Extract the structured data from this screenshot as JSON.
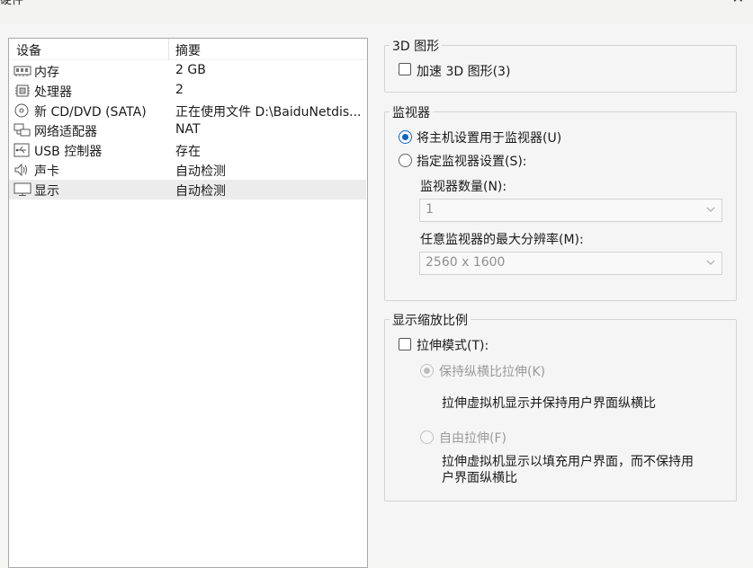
{
  "window": {
    "title": "硬件",
    "close_icon": "close-icon"
  },
  "devices": {
    "col_device": "设备",
    "col_summary": "摘要",
    "items": [
      {
        "name": "内存",
        "summary": "2 GB",
        "icon": "memory-icon"
      },
      {
        "name": "处理器",
        "summary": "2",
        "icon": "cpu-icon"
      },
      {
        "name": "新 CD/DVD (SATA)",
        "summary": "正在使用文件 D:\\BaiduNetdis...",
        "icon": "cd-dvd-icon"
      },
      {
        "name": "网络适配器",
        "summary": "NAT",
        "icon": "network-icon"
      },
      {
        "name": "USB 控制器",
        "summary": "存在",
        "icon": "usb-icon"
      },
      {
        "name": "声卡",
        "summary": "自动检测",
        "icon": "speaker-icon"
      },
      {
        "name": "显示",
        "summary": "自动检测",
        "icon": "monitor-icon",
        "selected": true
      }
    ]
  },
  "graphics3d": {
    "title": "3D 图形",
    "accelerate_label": "加速 3D 图形(3)",
    "accelerate_checked": false
  },
  "monitors": {
    "title": "监视器",
    "use_host_label": "将主机设置用于监视器(U)",
    "use_host_checked": true,
    "specify_label": "指定监视器设置(S):",
    "count_label": "监视器数量(N):",
    "count_value": "1",
    "max_res_label": "任意监视器的最大分辨率(M):",
    "max_res_value": "2560 x 1600"
  },
  "scaling": {
    "title": "显示缩放比例",
    "stretch_label": "拉伸模式(T):",
    "stretch_checked": false,
    "keep_ratio_label": "保持纵横比拉伸(K)",
    "keep_ratio_desc": "拉伸虚拟机显示并保持用户界面纵横比",
    "free_label": "自由拉伸(F)",
    "free_desc_line1": "拉伸虚拟机显示以填充用户界面，而不保持用",
    "free_desc_line2": "户界面纵横比"
  },
  "colors": {
    "accent": "#0a64c8",
    "selected_row": "#ececec",
    "disabled_text": "#9a9a9a"
  }
}
